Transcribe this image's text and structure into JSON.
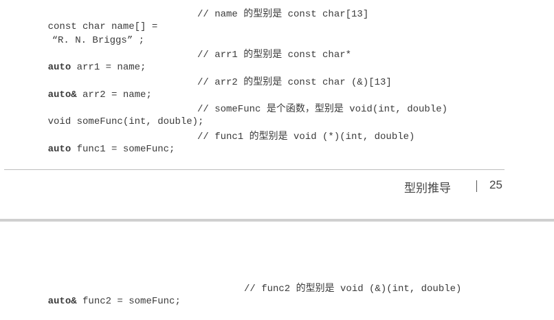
{
  "top_page": {
    "code_lines": [
      {
        "code_a": "const char name[] =",
        "code_b": "“R. N. Briggs” ;",
        "comment": "// name 的型别是 const char[13]"
      },
      {
        "kw": "auto",
        "code": " arr1 = name;",
        "comment": "// arr1 的型别是 const char*"
      },
      {
        "kw": "auto&",
        "code": " arr2 = name;",
        "comment": "// arr2 的型别是 const char (&)[13]"
      },
      {
        "code": "void someFunc(int, double);",
        "comment": "// someFunc 是个函数，型别是 void(int, double)"
      },
      {
        "kw": "auto",
        "code": " func1 = someFunc;",
        "comment": "// func1 的型别是 void (*)(int, double)"
      }
    ],
    "footer": {
      "section_title": "型别推导",
      "page_number": "25"
    }
  },
  "bottom_page": {
    "code_lines": [
      {
        "kw": "auto&",
        "code": " func2 = someFunc;",
        "comment": "// func2 的型别是 void (&)(int, double)"
      }
    ]
  }
}
